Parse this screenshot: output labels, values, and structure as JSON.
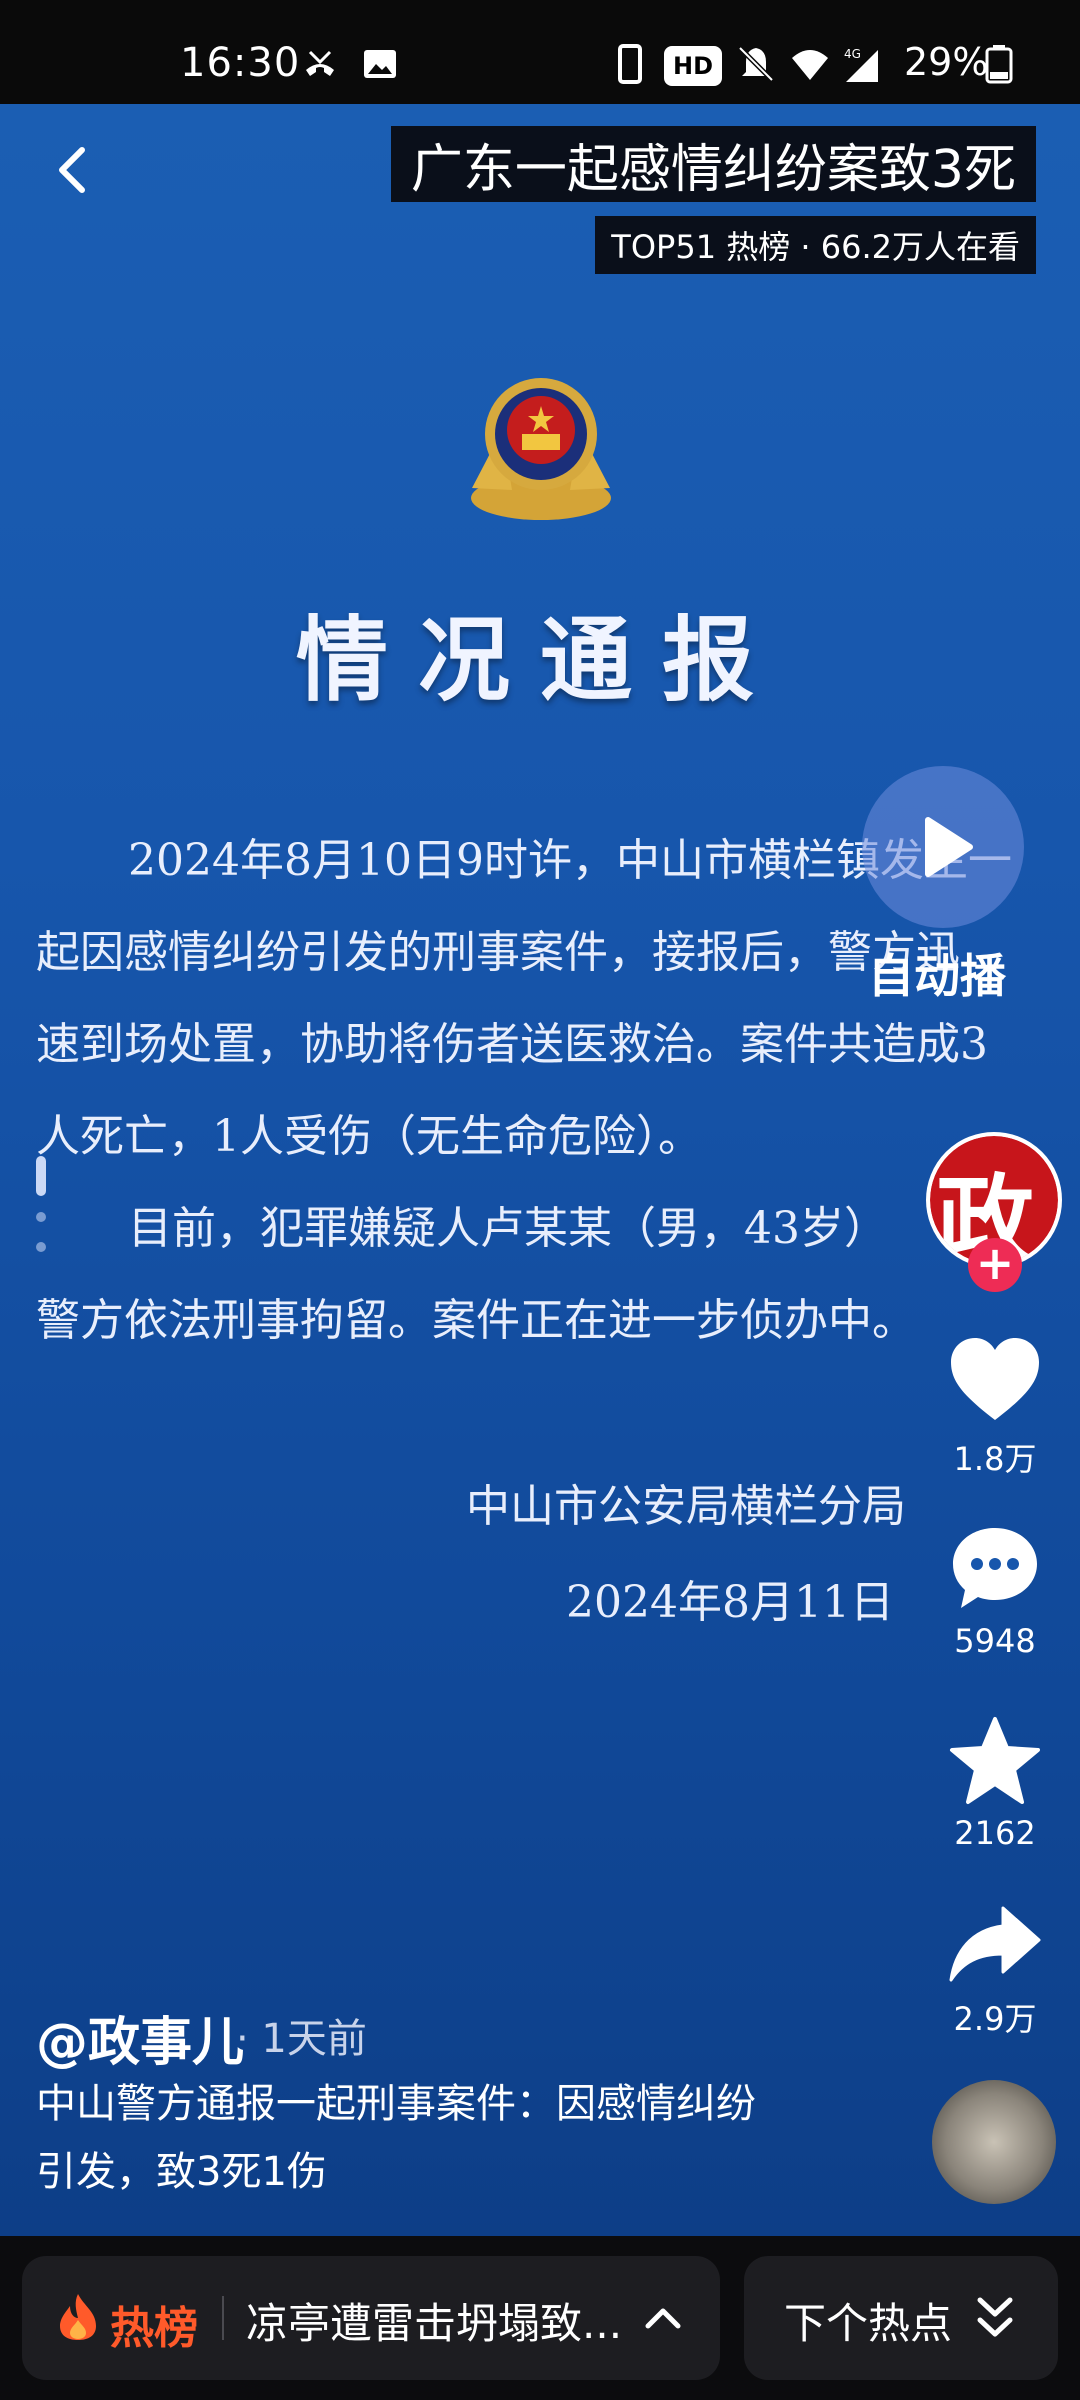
{
  "status_bar": {
    "time": "16:30",
    "hd_badge": "HD",
    "battery": "29%",
    "network": "4G"
  },
  "header": {
    "title": "广东一起感情纠纷案致3死",
    "subtitle": "TOP51 热榜 · 66.2万人在看"
  },
  "notice": {
    "headline": "情况通报",
    "line_1": "2024年8月10日9时许，中山市横栏镇发生一",
    "line_2": "起因感情纠纷引发的刑事案件，接报后，警方迅",
    "line_3": "速到场处置，协助将伤者送医救治。案件共造成3",
    "line_4": "人死亡，1人受伤（无生命危险）。",
    "line_5": "目前，犯罪嫌疑人卢某某（男，43岁）",
    "line_6": "警方依法刑事拘留。案件正在进一步侦办中。",
    "signature_org": "中山市公安局横栏分局",
    "signature_date": "2024年8月11日"
  },
  "autoplay": {
    "label": "自动播"
  },
  "rail": {
    "avatar_char": "政",
    "follow": "+",
    "likes": "1.8万",
    "comments": "5948",
    "favorites": "2162",
    "shares": "2.9万"
  },
  "post": {
    "author": "@政事儿",
    "time_ago": "· 1天前",
    "caption_line_1": "中山警方通报一起刑事案件：因感情纠纷",
    "caption_line_2": "引发，致3死1伤"
  },
  "bottom_bar": {
    "hot_label": "热榜",
    "hot_topic": "凉亭遭雷击坍塌致...",
    "next_label": "下个热点"
  },
  "colors": {
    "background_blue": "#1756ac",
    "accent_red": "#ee2c55",
    "hot_orange": "#ff5a2a"
  }
}
